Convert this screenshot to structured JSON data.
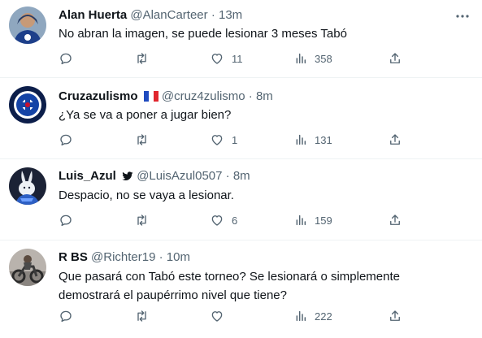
{
  "tweets": [
    {
      "name": "Alan Huerta",
      "handle": "@AlanCarteer",
      "time": "13m",
      "text": [
        "No abran la imagen, se puede lesionar 3 meses Tabó"
      ],
      "likes": "11",
      "views": "358",
      "avatar": "avatar-alan"
    },
    {
      "name": "Cruzazulismo",
      "handle": "@cruz4zulismo",
      "time": "8m",
      "text": [
        "¿Ya se va a poner a jugar bien?"
      ],
      "likes": "1",
      "views": "131",
      "badge": "france-flag-icon",
      "avatar": "avatar-cruz-azul-logo"
    },
    {
      "name": "Luis_Azul",
      "handle": "@LuisAzul0507",
      "time": "8m",
      "text": [
        "Despacio, no se vaya a lesionar."
      ],
      "likes": "6",
      "views": "159",
      "badge": "twitter-bird-icon",
      "avatar": "avatar-rabbit"
    },
    {
      "name": "R BS",
      "handle": "@Richter19",
      "time": "10m",
      "text": [
        "Que pasará con Tabó este torneo? Se lesionará o simplemente",
        "demostrará el paupérrimo nivel que tiene?"
      ],
      "likes": "",
      "views": "222",
      "avatar": "avatar-motorcycle"
    }
  ],
  "separator": "·",
  "colors": {
    "secondary_text": "#536471",
    "divider": "#eff3f4",
    "primary_text": "#0f1419"
  }
}
